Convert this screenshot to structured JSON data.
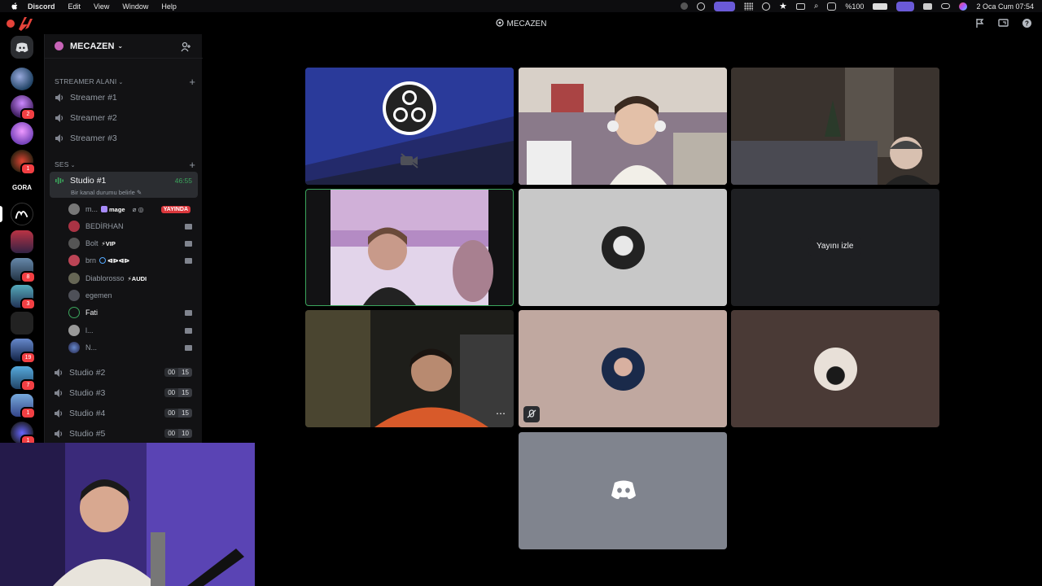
{
  "menubar": {
    "items": [
      "Discord",
      "Edit",
      "View",
      "Window",
      "Help"
    ],
    "battery": "%100",
    "clock": "2 Oca Cum  07:54"
  },
  "titlebar": {
    "title": "MECAZEN"
  },
  "rail": {
    "text_server": "GORA",
    "badges": [
      "2",
      "1",
      "8",
      "3",
      "19",
      "7",
      "1",
      "1"
    ]
  },
  "sidebar": {
    "server_name": "MECAZEN",
    "category_streamer": "STREAMER ALANI",
    "streamer_channels": [
      "Streamer #1",
      "Streamer #2",
      "Streamer #3"
    ],
    "category_voice": "SES",
    "active_channel": {
      "name": "Studio #1",
      "timer": "46:55",
      "status": "Bir kanal durumu belirle"
    },
    "users": [
      {
        "name": "m...",
        "tag": "mage",
        "live": "YAYINDA"
      },
      {
        "name": "BEDİRHAN"
      },
      {
        "name": "Bolt",
        "tag": "⚡VIP"
      },
      {
        "name": "brn",
        "tag": "ᐊᐅᐊᐅ"
      },
      {
        "name": "Diablorosso",
        "tag": "⚡AUDI"
      },
      {
        "name": "egemen"
      },
      {
        "name": "Fati"
      },
      {
        "name": "l..."
      },
      {
        "name": "N..."
      }
    ],
    "other_channels": [
      {
        "name": "Studio #2",
        "count": "00",
        "limit": "15"
      },
      {
        "name": "Studio #3",
        "count": "00",
        "limit": "15"
      },
      {
        "name": "Studio #4",
        "count": "00",
        "limit": "15"
      },
      {
        "name": "Studio #5",
        "count": "00",
        "limit": "10"
      }
    ]
  },
  "main": {
    "watch_stream_label": "Yayını izle"
  },
  "colors": {
    "accent": "#5865f2",
    "live_red": "#da373c",
    "speaking_green": "#3ba55c"
  }
}
